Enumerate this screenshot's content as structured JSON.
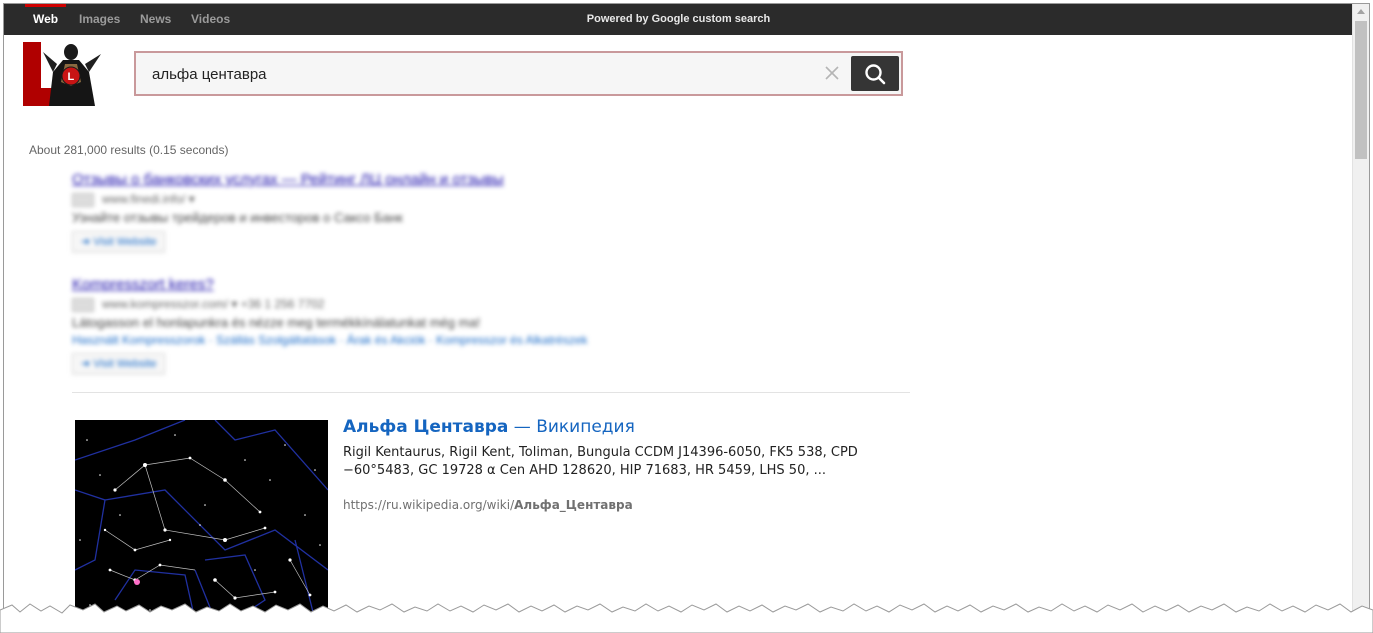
{
  "nav": {
    "tabs": [
      {
        "label": "Web",
        "active": true
      },
      {
        "label": "Images",
        "active": false
      },
      {
        "label": "News",
        "active": false
      },
      {
        "label": "Videos",
        "active": false
      }
    ],
    "powered_by": "Powered by Google custom search"
  },
  "search": {
    "query": "альфа центавра"
  },
  "stats": "About 281,000 results (0.15 seconds)",
  "ads": [
    {
      "title": "Отзывы о банковских услугах — Рейтинг ЛЦ онлайн и отзывы",
      "url": "www.finedi.info/ ▾",
      "desc": "Узнайте отзывы трейдеров и инвесторов о Саксо Банк",
      "visit": "➜ Visit Website"
    },
    {
      "title": "Kompresszort keres?",
      "url": "www.kompresszor.com/ ▾      +36 1 256 7702",
      "desc": "Látogasson el honlapunkra és nézze meg termékkínálatunkat még ma!",
      "sitelinks": "Használt Kompresszorok  ·  Szállás Szolgáltatások  ·  Árak és Akciók  ·  Kompresszor és Alkatrészek",
      "visit": "➜ Visit Website"
    }
  ],
  "result": {
    "title_main": "Альфа Центавра",
    "title_sep": " — ",
    "title_site": "Википедия",
    "snippet": "Rigil Kentaurus, Rigil Kent, Toliman, Bungula CCDM J14396-6050, FK5 538, CPD −60°5483, GC 19728 α Cen AHD 128620, HIP 71683, HR 5459, LHS 50, ...",
    "url_prefix": "https://ru.wikipedia.org/wiki/",
    "url_bold": "Альфа_Центавра"
  },
  "colors": {
    "topbar": "#2b2b2b",
    "active_tab_marker": "#d10000",
    "search_border": "#c9999b",
    "result_title": "#1565c0"
  },
  "icons": [
    "logo-superhero-icon",
    "clear-icon",
    "search-icon"
  ]
}
